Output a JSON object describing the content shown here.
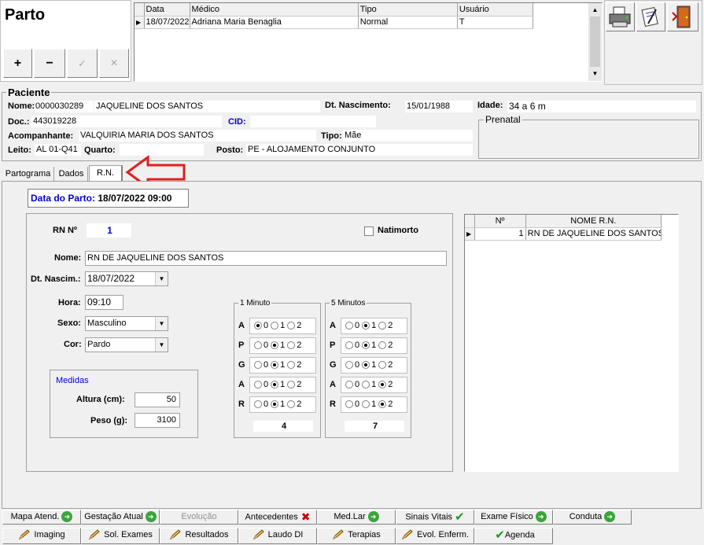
{
  "title": "Parto",
  "toolbar": {
    "add": "+",
    "remove": "−",
    "confirm": "✓",
    "cancel": "✕"
  },
  "top_grid": {
    "columns": [
      "Data",
      "Médico",
      "Tipo",
      "Usuário"
    ],
    "rows": [
      {
        "data": "18/07/2022",
        "medico": "Adriana Maria Benaglia",
        "tipo": "Normal",
        "usuario": "T"
      }
    ]
  },
  "paciente": {
    "section": "Paciente",
    "nome_label": "Nome:",
    "nome_code": "0000030289",
    "nome": "JAQUELINE DOS SANTOS",
    "dt_nasc_label": "Dt. Nascimento:",
    "dt_nasc": "15/01/1988",
    "idade_label": "Idade:",
    "idade": "34 a 6 m",
    "doc_label": "Doc.:",
    "doc": "443019228",
    "cid_label": "CID:",
    "cid": "",
    "acomp_label": "Acompanhante:",
    "acomp": "VALQUIRIA MARIA DOS SANTOS",
    "tipo_label": "Tipo:",
    "tipo": "Mãe",
    "leito_label": "Leito:",
    "leito": "AL 01-Q41",
    "quarto_label": "Quarto:",
    "quarto": "",
    "posto_label": "Posto:",
    "posto": "PE - ALOJAMENTO CONJUNTO",
    "prenatal": "Prenatal"
  },
  "tabs": [
    {
      "label": "Partograma"
    },
    {
      "label": "Dados"
    },
    {
      "label": "R.N."
    }
  ],
  "rn": {
    "data_parto_label": "Data do Parto:",
    "data_parto": "18/07/2022 09:00",
    "rn_label": "RN  Nº",
    "rn_num": "1",
    "natimorto": "Natimorto",
    "nome_label": "Nome:",
    "nome": "RN DE JAQUELINE DOS SANTOS",
    "dtnasc_label": "Dt. Nascim.:",
    "dtnasc": "18/07/2022",
    "hora_label": "Hora:",
    "hora": "09:10",
    "sexo_label": "Sexo:",
    "sexo": "Masculino",
    "cor_label": "Cor:",
    "cor": "Pardo",
    "medidas": "Medidas",
    "altura_label": "Altura (cm):",
    "altura": "50",
    "peso_label": "Peso (g):",
    "peso": "3100"
  },
  "apgar": {
    "m1_title": "1 Minuto",
    "m5_title": "5 Minutos",
    "letters": [
      "A",
      "P",
      "G",
      "A",
      "R"
    ],
    "opts": [
      "0",
      "1",
      "2"
    ],
    "m1_sel": [
      0,
      1,
      1,
      1,
      1
    ],
    "m5_sel": [
      1,
      1,
      1,
      2,
      2
    ],
    "m1_total": "4",
    "m5_total": "7"
  },
  "rn_grid": {
    "columns": [
      "Nº",
      "NOME R.N."
    ],
    "rows": [
      {
        "num": "1",
        "nome": "RN DE JAQUELINE DOS SANTOS"
      }
    ]
  },
  "bottom_row1": [
    {
      "label": "Mapa Atend.",
      "icon": "go"
    },
    {
      "label": "Gestação Atual",
      "icon": "go"
    },
    {
      "label": "Evolução",
      "icon": ""
    },
    {
      "label": "Antecedentes",
      "icon": "x"
    },
    {
      "label": "Med.Lar",
      "icon": "go"
    },
    {
      "label": "Sinais Vitais",
      "icon": "check"
    },
    {
      "label": "Exame Físico",
      "icon": "go"
    },
    {
      "label": "Conduta",
      "icon": "go"
    }
  ],
  "bottom_row2": [
    {
      "label": "Imaging",
      "icon": "pen"
    },
    {
      "label": "Sol. Exames",
      "icon": "pen"
    },
    {
      "label": "Resultados",
      "icon": "pen"
    },
    {
      "label": "Laudo DI",
      "icon": "pen"
    },
    {
      "label": "Terapias",
      "icon": "pen"
    },
    {
      "label": "Evol. Enferm.",
      "icon": "pen"
    },
    {
      "label": "Agenda",
      "icon": "check"
    }
  ],
  "colors": {
    "accent_blue": "#0000cc",
    "arrow_red": "#e0201e",
    "go_green": "#3aa63a"
  }
}
